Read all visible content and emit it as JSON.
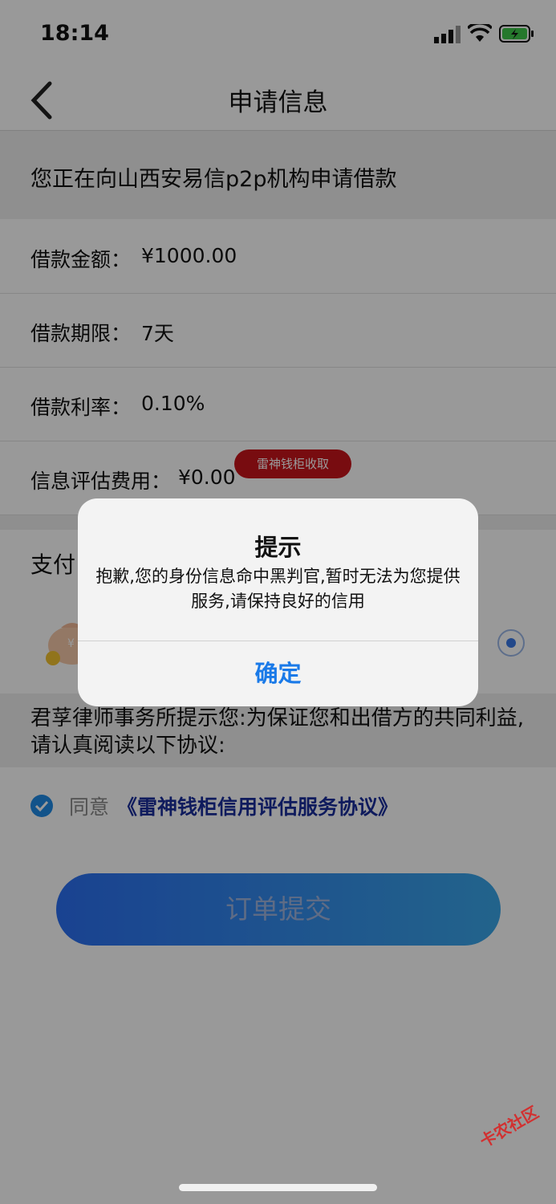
{
  "status_bar": {
    "time": "18:14"
  },
  "nav": {
    "title": "申请信息"
  },
  "notice": "您正在向山西安易信p2p机构申请借款",
  "loan_rows": [
    {
      "label": "借款金额：",
      "value": "¥1000.00"
    },
    {
      "label": "借款期限：",
      "value": "7天"
    },
    {
      "label": "借款利率：",
      "value": "0.10%"
    },
    {
      "label": "信息评估费用：",
      "value": "¥0.00"
    }
  ],
  "fee_badge": "雷神钱柜收取",
  "payment": {
    "label": "支付"
  },
  "law_notice": "君莩律师事务所提示您:为保证您和出借方的共同利益,请认真阅读以下协议:",
  "agreement": {
    "prefix": "同意",
    "link": "《雷神钱柜信用评估服务协议》"
  },
  "submit_label": "订单提交",
  "dialog": {
    "title": "提示",
    "message": "抱歉,您的身份信息命中黑判官,暂时无法为您提供服务,请保持良好的信用",
    "confirm_label": "确定"
  },
  "watermark": "卡农社区",
  "colors": {
    "accent": "#1a7ae8",
    "badge": "#c8141b",
    "link": "#1a2e9c"
  }
}
